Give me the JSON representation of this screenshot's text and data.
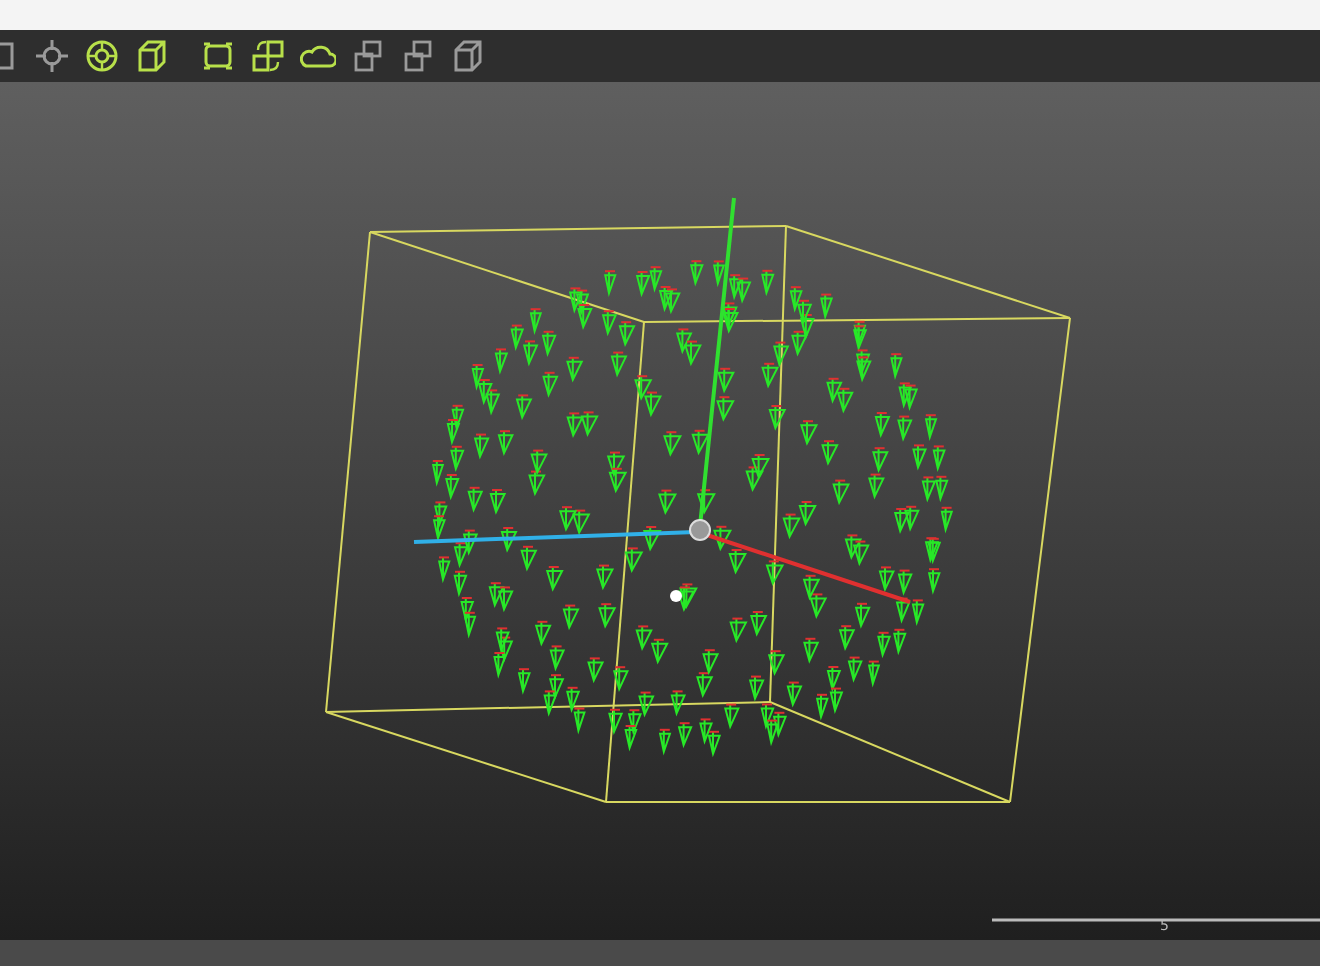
{
  "toolbar": {
    "icons": [
      {
        "kind": "frame",
        "active": false
      },
      {
        "kind": "move",
        "active": false
      },
      {
        "kind": "target",
        "active": true
      },
      {
        "kind": "cube",
        "active": true
      },
      {
        "kind": "group",
        "active": true
      },
      {
        "kind": "swap",
        "active": true
      },
      {
        "kind": "cloud",
        "active": true
      },
      {
        "kind": "stack",
        "active": false
      },
      {
        "kind": "stack",
        "active": false
      },
      {
        "kind": "cube",
        "active": false
      }
    ]
  },
  "timeline": {
    "tick_label": "5"
  }
}
